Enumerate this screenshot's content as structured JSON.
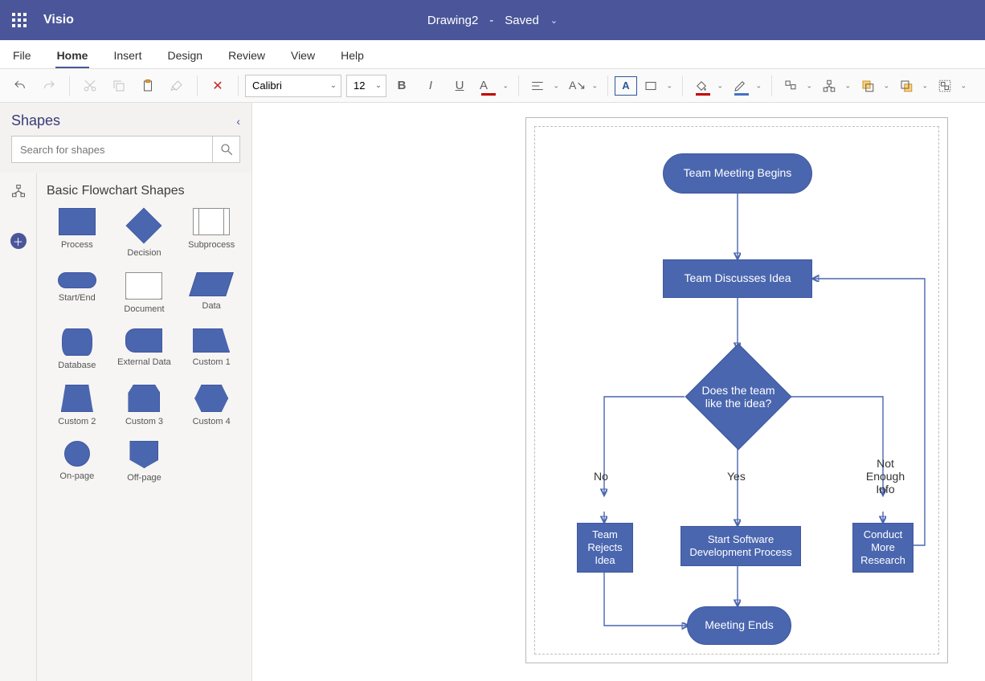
{
  "app_name": "Visio",
  "document": {
    "title": "Drawing2",
    "status": "Saved"
  },
  "tabs": [
    "File",
    "Home",
    "Insert",
    "Design",
    "Review",
    "View",
    "Help"
  ],
  "active_tab": "Home",
  "ribbon": {
    "font_name": "Calibri",
    "font_size": "12"
  },
  "shapes_panel": {
    "title": "Shapes",
    "search_placeholder": "Search for shapes",
    "stencil_title": "Basic Flowchart Shapes",
    "shapes": [
      "Process",
      "Decision",
      "Subprocess",
      "Start/End",
      "Document",
      "Data",
      "Database",
      "External Data",
      "Custom 1",
      "Custom 2",
      "Custom 3",
      "Custom 4",
      "On-page",
      "Off-page"
    ]
  },
  "flowchart": {
    "nodes": {
      "start": "Team Meeting Begins",
      "discuss": "Team Discusses Idea",
      "decision": "Does the team like the idea?",
      "reject": "Team Rejects Idea",
      "develop": "Start Software Development Process",
      "research": "Conduct More Research",
      "end": "Meeting Ends"
    },
    "labels": {
      "no": "No",
      "yes": "Yes",
      "not_enough": "Not Enough Info"
    }
  }
}
